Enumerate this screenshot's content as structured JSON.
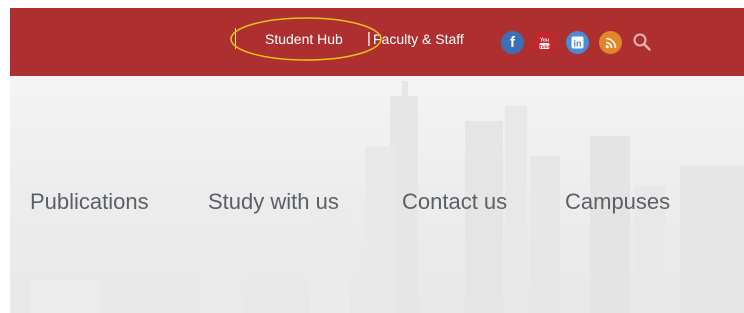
{
  "topbar": {
    "background": "#ae2f30",
    "links": [
      {
        "label": "Student Hub"
      },
      {
        "label": "Faculty & Staff"
      }
    ],
    "separator": "|",
    "social": [
      {
        "name": "facebook-icon",
        "glyph": "f",
        "color": "#3b6fb6"
      },
      {
        "name": "youtube-icon",
        "glyph": "You",
        "color": "#c4262e"
      },
      {
        "name": "linkedin-icon",
        "glyph": "in",
        "color": "#4a8ad6"
      },
      {
        "name": "rss-icon",
        "glyph": "rss",
        "color": "#e3862b"
      }
    ],
    "search_icon": "search-icon"
  },
  "nav": {
    "items": [
      {
        "label": "Publications"
      },
      {
        "label": "Study with us"
      },
      {
        "label": "Contact us"
      },
      {
        "label": "Campuses"
      }
    ]
  },
  "annotation": {
    "shape": "ellipse",
    "color": "#e8c21b"
  }
}
